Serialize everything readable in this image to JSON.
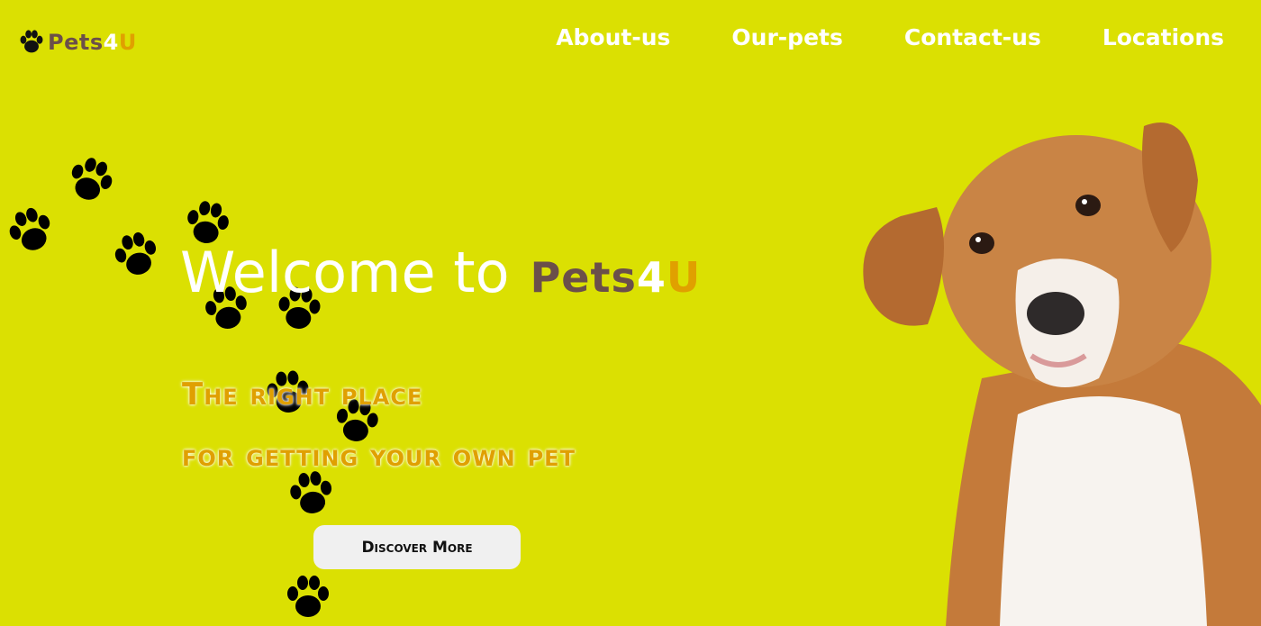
{
  "brand": {
    "part_a": "Pets",
    "part_b": "4",
    "part_c": "U"
  },
  "nav": {
    "items": [
      {
        "label": "About-us"
      },
      {
        "label": "Our-pets"
      },
      {
        "label": "Contact-us"
      },
      {
        "label": "Locations"
      }
    ]
  },
  "hero": {
    "welcome": "Welcome to",
    "tagline_line1": "The right place",
    "tagline_line2": "for getting your own pet",
    "cta_label": "Discover More"
  },
  "colors": {
    "background": "#dbe002",
    "brand_brown": "#6b4f4a",
    "brand_orange": "#e0a000",
    "white": "#ffffff"
  },
  "icons": {
    "logo_icon": "paw-icon",
    "decor": "paw-print-trail"
  }
}
